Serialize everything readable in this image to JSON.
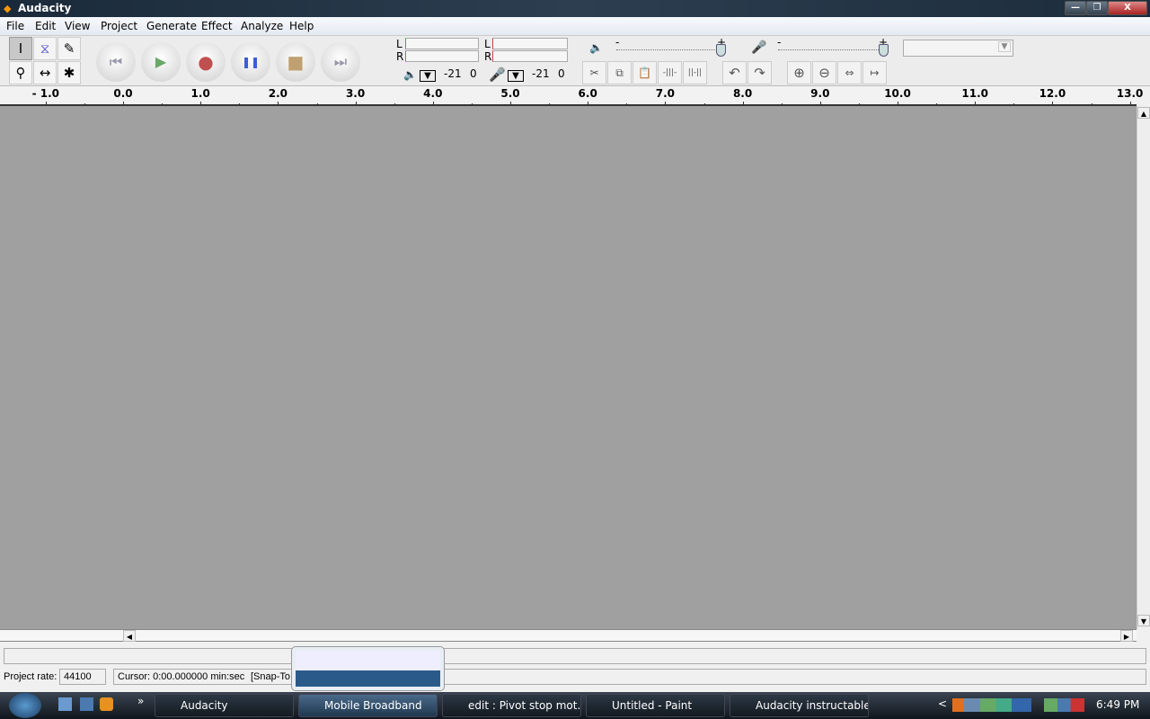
{
  "window": {
    "title": "Audacity",
    "minimize": "—",
    "restore": "❐",
    "close": "X"
  },
  "menu": [
    "File",
    "Edit",
    "View",
    "Project",
    "Generate",
    "Effect",
    "Analyze",
    "Help"
  ],
  "tools": {
    "selection": "I",
    "envelope": "⧖",
    "draw": "✎",
    "zoom": "⚲",
    "timeshift": "↔",
    "multi": "✱"
  },
  "transport": {
    "skip_start": "⏮",
    "play": "▶",
    "record": "●",
    "pause": "❚❚",
    "stop": "■",
    "skip_end": "⏭"
  },
  "meters": {
    "left": "L",
    "right": "R",
    "playback_db": "-21",
    "playback_zero": "0",
    "record_db": "-21",
    "record_zero": "0"
  },
  "mixer": {
    "minus": "-",
    "plus": "+"
  },
  "edit_tools": {
    "trim": "✂",
    "copy": "⧉",
    "paste": "📋",
    "silence": "-|||-",
    "trim_audio": "||-||",
    "undo": "↶",
    "redo": "↷",
    "zoom_in": "⊕",
    "zoom_out": "⊖",
    "fit_selection": "⇔",
    "fit_project": "↦"
  },
  "ruler": {
    "ticks": [
      "- 1.0",
      "0.0",
      "1.0",
      "2.0",
      "3.0",
      "4.0",
      "5.0",
      "6.0",
      "7.0",
      "8.0",
      "9.0",
      "10.0",
      "11.0",
      "12.0",
      "13.0"
    ],
    "values": [
      -1,
      0,
      1,
      2,
      3,
      4,
      5,
      6,
      7,
      8,
      9,
      10,
      11,
      12,
      13
    ]
  },
  "status": {
    "project_rate_label": "Project rate:",
    "project_rate": "44100",
    "cursor": "Cursor: 0:00.000000 min:sec",
    "snap": "[Snap-To"
  },
  "taskbar": {
    "items": [
      "Audacity",
      "Mobile Broadband",
      "edit : Pivot stop mot...",
      "Untitled - Paint",
      "Audacity instructable"
    ],
    "overflow": "»",
    "tray_expand": "<",
    "clock": "6:49 PM"
  },
  "colors": {
    "track_bg": "#a0a0a0",
    "play": "#6aa86a",
    "record": "#c05050",
    "pause": "#3a5fd0",
    "stop": "#c0a070"
  }
}
